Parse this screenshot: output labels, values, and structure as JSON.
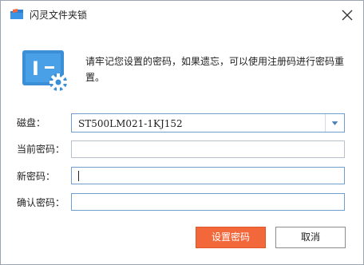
{
  "window": {
    "title": "闪灵文件夹锁",
    "notice": "请牢记您设置的密码，如果遗忘，可以使用注册码进行密码重置。",
    "hero_icon_letter": "I"
  },
  "form": {
    "disk_label": "磁盘：",
    "disk_value": "ST500LM021-1KJ152",
    "current_password_label": "当前密码：",
    "current_password_value": "",
    "new_password_label": "新密码：",
    "new_password_value": "",
    "confirm_password_label": "确认密码：",
    "confirm_password_value": ""
  },
  "buttons": {
    "set_password": "设置密码",
    "cancel": "取消"
  },
  "colors": {
    "accent": "#f2683a",
    "icon_blue": "#3a8fd6",
    "focus_border": "#6f9fcf"
  }
}
